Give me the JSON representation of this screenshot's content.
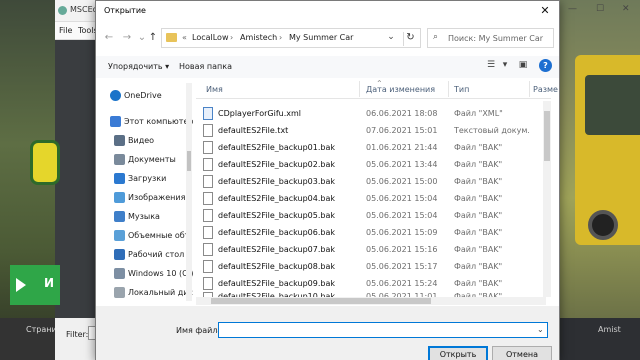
{
  "bg_app": {
    "title": "MSCEd",
    "menu": [
      "File",
      "Tools"
    ],
    "play_label": "И",
    "left_bottom_label": "Страни",
    "filter_label": "Filter:",
    "right_bottom_label": "Amist"
  },
  "dialog": {
    "title": "Открытие",
    "close_glyph": "✕",
    "breadcrumb": {
      "prefix": "«",
      "segments": [
        "LocalLow",
        "Amistech",
        "My Summer Car"
      ],
      "separator": "›"
    },
    "search_placeholder": "Поиск: My Summer Car",
    "toolbar": {
      "organize_label": "Упорядочить ▾",
      "new_folder_label": "Новая папка"
    },
    "nav_items": [
      {
        "label": "OneDrive",
        "icon": "cloud-icon",
        "color": "#1a73c9"
      },
      {
        "label": "Этот компьютер",
        "icon": "computer-icon",
        "color": "#3a7bd5"
      },
      {
        "label": "Видео",
        "icon": "video-icon",
        "color": "#5b6f86"
      },
      {
        "label": "Документы",
        "icon": "documents-icon",
        "color": "#7a8a9b"
      },
      {
        "label": "Загрузки",
        "icon": "downloads-icon",
        "color": "#2b79d0"
      },
      {
        "label": "Изображения",
        "icon": "pictures-icon",
        "color": "#4f9bd9"
      },
      {
        "label": "Музыка",
        "icon": "music-icon",
        "color": "#3f7fc9"
      },
      {
        "label": "Объемные объ",
        "icon": "3d-objects-icon",
        "color": "#5aa0d8"
      },
      {
        "label": "Рабочий стол",
        "icon": "desktop-icon",
        "color": "#2f6db8"
      },
      {
        "label": "Windows 10 (C:)",
        "icon": "drive-icon",
        "color": "#7d8fa3"
      },
      {
        "label": "Локальный дис",
        "icon": "drive-icon",
        "color": "#9aa4ad"
      }
    ],
    "columns": {
      "name": "Имя",
      "date": "Дата изменения",
      "type": "Тип",
      "size": "Разме"
    },
    "files": [
      {
        "name": "CDplayerForGifu.xml",
        "date": "06.06.2021 18:08",
        "type": "Файл \"XML\"",
        "kind": "xml"
      },
      {
        "name": "defaultES2File.txt",
        "date": "07.06.2021 15:01",
        "type": "Текстовый докум...",
        "kind": "txt"
      },
      {
        "name": "defaultES2File_backup01.bak",
        "date": "01.06.2021 21:44",
        "type": "Файл \"BAK\"",
        "kind": "bak"
      },
      {
        "name": "defaultES2File_backup02.bak",
        "date": "05.06.2021 13:44",
        "type": "Файл \"BAK\"",
        "kind": "bak"
      },
      {
        "name": "defaultES2File_backup03.bak",
        "date": "05.06.2021 15:00",
        "type": "Файл \"BAK\"",
        "kind": "bak"
      },
      {
        "name": "defaultES2File_backup04.bak",
        "date": "05.06.2021 15:04",
        "type": "Файл \"BAK\"",
        "kind": "bak"
      },
      {
        "name": "defaultES2File_backup05.bak",
        "date": "05.06.2021 15:04",
        "type": "Файл \"BAK\"",
        "kind": "bak"
      },
      {
        "name": "defaultES2File_backup06.bak",
        "date": "05.06.2021 15:09",
        "type": "Файл \"BAK\"",
        "kind": "bak"
      },
      {
        "name": "defaultES2File_backup07.bak",
        "date": "05.06.2021 15:16",
        "type": "Файл \"BAK\"",
        "kind": "bak"
      },
      {
        "name": "defaultES2File_backup08.bak",
        "date": "05.06.2021 15:17",
        "type": "Файл \"BAK\"",
        "kind": "bak"
      },
      {
        "name": "defaultES2File_backup09.bak",
        "date": "05.06.2021 15:24",
        "type": "Файл \"BAK\"",
        "kind": "bak"
      },
      {
        "name": "defaultES2File_backup10.bak",
        "date": "05.06.2021 11:01",
        "type": "Файл \"BAK\"",
        "kind": "bak"
      }
    ],
    "filename_label": "Имя файла:",
    "filename_value": "",
    "open_label": "Открыть",
    "cancel_label": "Отмена"
  },
  "colors": {
    "accent": "#0078d7",
    "folder": "#e8c35a"
  }
}
